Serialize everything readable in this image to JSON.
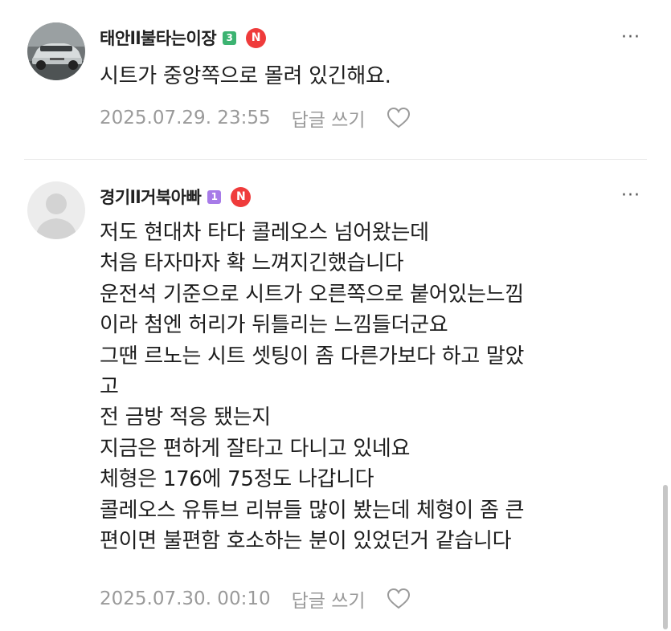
{
  "comments": [
    {
      "nickname": "태안ll불타는이장",
      "level": "3",
      "badge": "N",
      "text": "시트가 중앙쪽으로 몰려 있긴해요.",
      "date": "2025.07.29. 23:55",
      "reply_label": "답글 쓰기",
      "more_label": "···"
    },
    {
      "nickname": "경기ll거북아빠",
      "level": "1",
      "badge": "N",
      "text": "저도 현대차 타다 콜레오스 넘어왔는데\n처음 타자마자 확 느껴지긴했습니다\n운전석 기준으로 시트가 오른쪽으로 붙어있는느낌\n이라 첨엔 허리가 뒤틀리는 느낌들더군요\n그땐 르노는 시트 셋팅이 좀 다른가보다 하고 말았\n고\n전 금방 적응 됐는지\n지금은 편하게 잘타고 다니고 있네요\n체형은 176에 75정도 나갑니다\n콜레오스 유튜브 리뷰들 많이 봤는데 체형이 좀 큰\n편이면 불편함 호소하는 분이 있었던거 같습니다",
      "date": "2025.07.30. 00:10",
      "reply_label": "답글 쓰기",
      "more_label": "···"
    }
  ],
  "colors": {
    "level_1": "#a77be8",
    "level_3": "#3cb371",
    "new_badge": "#ef3b3b",
    "meta_text": "#9a9a9a"
  },
  "icons": {
    "more": "more-dots-icon",
    "like": "heart-icon",
    "avatar_default": "person-silhouette-icon"
  }
}
